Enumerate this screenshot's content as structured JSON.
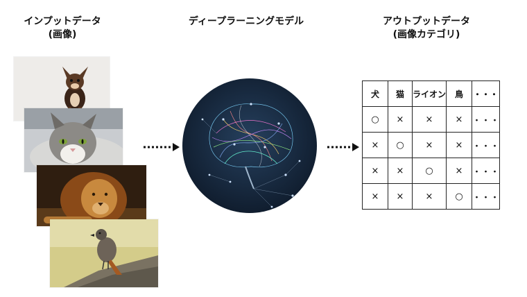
{
  "headings": {
    "input_line1": "インプットデータ",
    "input_line2": "(画像)",
    "model": "ディープラーニングモデル",
    "output_line1": "アウトプットデータ",
    "output_line2": "(画像カテゴリ)"
  },
  "images": [
    {
      "subject": "chihuahua-dog"
    },
    {
      "subject": "cat"
    },
    {
      "subject": "lion"
    },
    {
      "subject": "bird"
    }
  ],
  "table": {
    "headers": [
      "犬",
      "猫",
      "ライオン",
      "鳥",
      "・・・"
    ],
    "rows": [
      [
        "○",
        "×",
        "×",
        "×",
        "・・・"
      ],
      [
        "×",
        "○",
        "×",
        "×",
        "・・・"
      ],
      [
        "×",
        "×",
        "○",
        "×",
        "・・・"
      ],
      [
        "×",
        "×",
        "×",
        "○",
        "・・・"
      ]
    ]
  },
  "colors": {
    "brain_bg": "#16243a",
    "arrow": "#111111"
  }
}
